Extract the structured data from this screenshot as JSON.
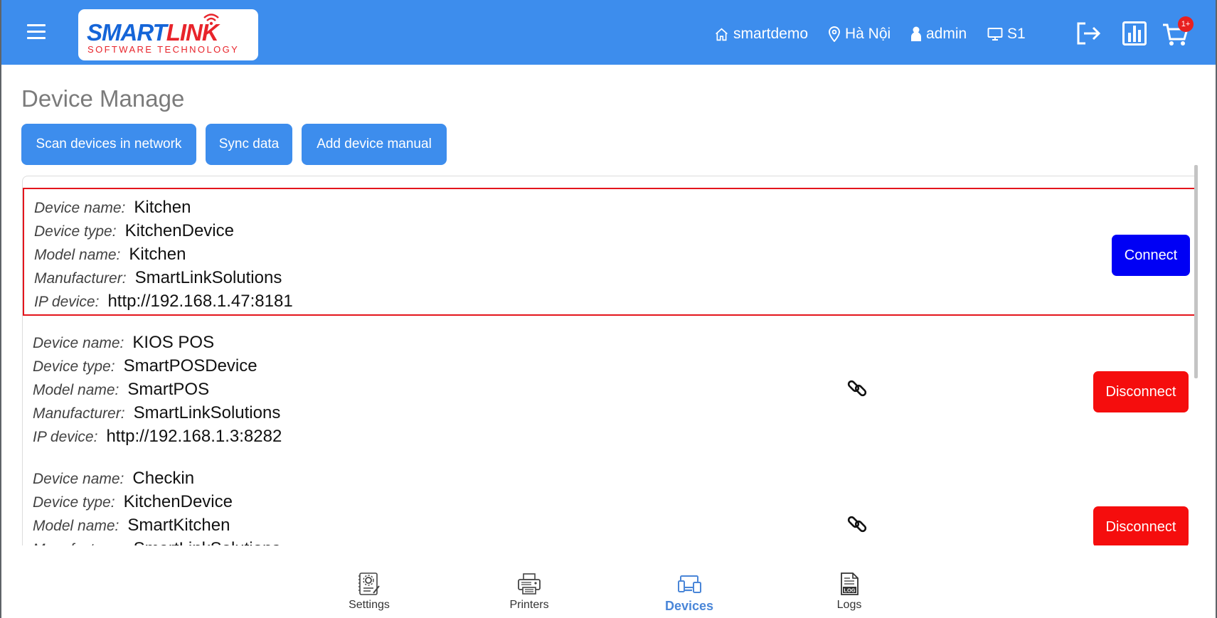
{
  "header": {
    "logo_main_part1": "SMART",
    "logo_main_part2": "LINK",
    "logo_sub": "SOFTWARE TECHNOLOGY",
    "store": "smartdemo",
    "location": "Hà Nội",
    "user": "admin",
    "station": "S1",
    "cart_badge": "1+"
  },
  "page": {
    "title": "Device Manage"
  },
  "toolbar": {
    "scan_label": "Scan devices in network",
    "sync_label": "Sync data",
    "add_label": "Add device manual"
  },
  "labels": {
    "device_name": "Device name:",
    "device_type": "Device type:",
    "model_name": "Model name:",
    "manufacturer": "Manufacturer:",
    "ip_device": "IP device:"
  },
  "devices": [
    {
      "name": "Kitchen",
      "type": "KitchenDevice",
      "model": "Kitchen",
      "manufacturer": "SmartLinkSolutions",
      "ip": "http://192.168.1.47:8181",
      "action": "Connect"
    },
    {
      "name": "KIOS POS",
      "type": "SmartPOSDevice",
      "model": "SmartPOS",
      "manufacturer": "SmartLinkSolutions",
      "ip": "http://192.168.1.3:8282",
      "action": "Disconnect"
    },
    {
      "name": "Checkin",
      "type": "KitchenDevice",
      "model": "SmartKitchen",
      "manufacturer": "SmartLinkSolutions",
      "action": "Disconnect"
    }
  ],
  "bottom_nav": [
    {
      "label": "Settings",
      "icon": "settings-icon"
    },
    {
      "label": "Printers",
      "icon": "printer-icon"
    },
    {
      "label": "Devices",
      "icon": "devices-icon",
      "active": true
    },
    {
      "label": "Logs",
      "icon": "log-icon"
    }
  ],
  "colors": {
    "header_bg": "#3d8ded",
    "connect": "#0000f5",
    "disconnect": "#f50d0d",
    "selected_border": "#e4151c",
    "nav_active": "#4a86d8"
  }
}
